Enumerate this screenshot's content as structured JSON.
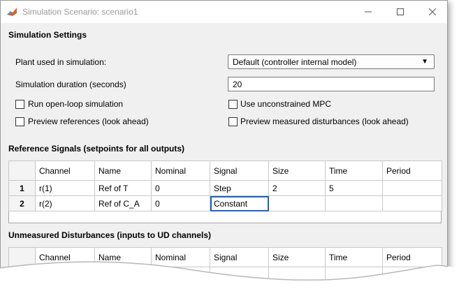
{
  "window": {
    "title": "Simulation Scenario: scenario1",
    "controls": {
      "minimize": "minimize-icon",
      "maximize": "maximize-icon",
      "close": "close-icon"
    }
  },
  "settings": {
    "section_title": "Simulation Settings",
    "plant_label": "Plant used in simulation:",
    "plant_value": "Default (controller internal model)",
    "duration_label": "Simulation duration (seconds)",
    "duration_value": "20",
    "checkboxes": {
      "open_loop": "Run open-loop simulation",
      "unconstrained": "Use unconstrained MPC",
      "preview_refs": "Preview references (look ahead)",
      "preview_md": "Preview measured disturbances (look ahead)"
    }
  },
  "reference": {
    "section_title": "Reference Signals (setpoints for all outputs)",
    "columns": [
      "Channel",
      "Name",
      "Nominal",
      "Signal",
      "Size",
      "Time",
      "Period"
    ],
    "rows": [
      {
        "index": "1",
        "channel": "r(1)",
        "name": "Ref of T",
        "nominal": "0",
        "signal": "Step",
        "size": "2",
        "time": "5",
        "period": ""
      },
      {
        "index": "2",
        "channel": "r(2)",
        "name": "Ref of C_A",
        "nominal": "0",
        "signal": "Constant",
        "size": "",
        "time": "",
        "period": ""
      }
    ]
  },
  "unmeasured": {
    "section_title": "Unmeasured Disturbances (inputs to UD channels)",
    "columns": [
      "Channel",
      "Name",
      "Nominal",
      "Signal",
      "Size",
      "Time",
      "Period"
    ]
  }
}
